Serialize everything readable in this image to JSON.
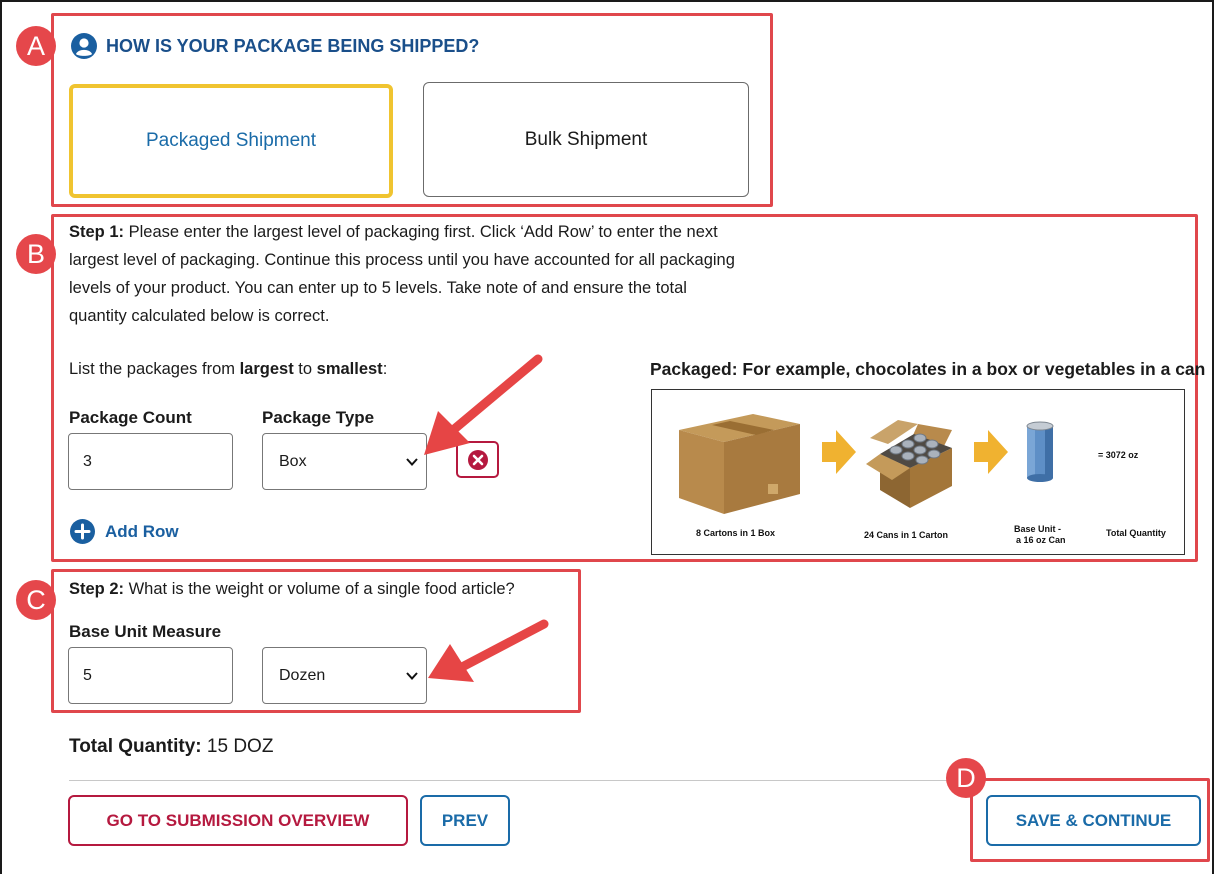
{
  "shipping": {
    "question": "HOW IS YOUR PACKAGE BEING SHIPPED?",
    "options": [
      "Packaged Shipment",
      "Bulk Shipment"
    ],
    "selected": "Packaged Shipment"
  },
  "callouts": [
    "A",
    "B",
    "C",
    "D"
  ],
  "step1": {
    "label": "Step 1:",
    "text_lines": [
      " Please enter the largest level of packaging first. Click ‘Add Row’ to enter the next",
      "largest level of packaging. Continue this process until you have accounted for all packaging",
      "levels of your product. You can enter up to 5 levels. Take note of and ensure the total",
      "quantity calculated below is correct."
    ],
    "list_prefix": "List the packages from ",
    "list_largest": "largest",
    "list_to": " to ",
    "list_smallest": "smallest",
    "list_suffix": ":",
    "package_count_label": "Package Count",
    "package_type_label": "Package Type",
    "package_count_value": "3",
    "package_type_value": "Box",
    "add_row": "Add Row"
  },
  "example": {
    "caption": "Packaged: For example, chocolates in a box or vegetables in a can",
    "total": "= 3072 oz",
    "labels": [
      "8 Cartons in 1 Box",
      "24 Cans in 1 Carton",
      "Base Unit -",
      "a 16 oz Can",
      "Total Quantity"
    ]
  },
  "step2": {
    "label": "Step 2:",
    "text": " What is the weight or volume of a single food article?",
    "measure_label": "Base Unit Measure",
    "measure_value": "5",
    "unit_value": "Dozen"
  },
  "total": {
    "label": "Total Quantity:",
    "value": " 15 DOZ"
  },
  "buttons": {
    "overview": "GO TO SUBMISSION OVERVIEW",
    "prev": "PREV",
    "save": "SAVE & CONTINUE"
  },
  "colors": {
    "accent_blue": "#1a6ba8",
    "callout_red": "#e0474c",
    "selected_border": "#f0c430",
    "danger": "#b5193f"
  }
}
